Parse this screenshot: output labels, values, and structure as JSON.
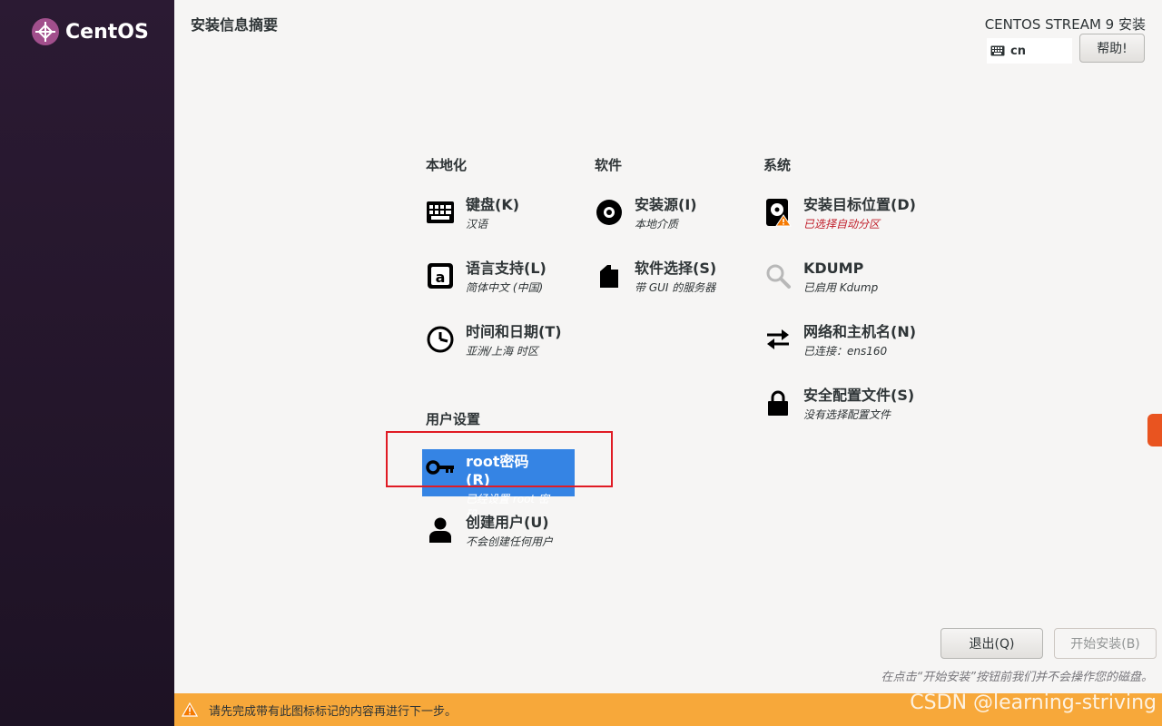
{
  "app": {
    "logo_text": "CentOS",
    "page_title": "安装信息摘要",
    "product_title": "CENTOS STREAM 9 安装",
    "keyboard_layout": "cn",
    "help_label": "帮助!"
  },
  "categories": {
    "localization": "本地化",
    "software": "软件",
    "system": "系统",
    "user_settings": "用户设置"
  },
  "spokes": {
    "keyboard": {
      "title": "键盘(K)",
      "status": "汉语",
      "icon": "keyboard-icon"
    },
    "language": {
      "title": "语言支持(L)",
      "status": "简体中文 (中国)",
      "icon": "language-icon"
    },
    "time": {
      "title": "时间和日期(T)",
      "status": "亚洲/上海 时区",
      "icon": "clock-icon"
    },
    "source": {
      "title": "安装源(I)",
      "status": "本地介质",
      "icon": "disc-icon"
    },
    "software": {
      "title": "软件选择(S)",
      "status": "带 GUI 的服务器",
      "icon": "package-icon"
    },
    "destination": {
      "title": "安装目标位置(D)",
      "status": "已选择自动分区",
      "icon": "harddisk-warning-icon"
    },
    "kdump": {
      "title": "KDUMP",
      "status": "已启用 Kdump",
      "icon": "magnifier-icon"
    },
    "network": {
      "title": "网络和主机名(N)",
      "status": "已连接：ens160",
      "icon": "network-arrows-icon"
    },
    "security": {
      "title": "安全配置文件(S)",
      "status": "没有选择配置文件",
      "icon": "lock-icon"
    },
    "root": {
      "title": "root密码(R)",
      "status": "已经设置 root 密码",
      "icon": "key-icon"
    },
    "user": {
      "title": "创建用户(U)",
      "status": "不会创建任何用户",
      "icon": "user-icon"
    }
  },
  "buttons": {
    "quit": "退出(Q)",
    "begin": "开始安装(B)"
  },
  "footnote": "在点击“开始安装”按钮前我们并不会操作您的磁盘。",
  "warning_bar": "请先完成带有此图标标记的内容再进行下一步。",
  "watermark": "CSDN @learning-striving",
  "colors": {
    "selection": "#3584e4",
    "warning_bar": "#f7a83a",
    "warning_text": "#c01c28",
    "sidebar": "#2b1a33",
    "highlight_border": "#e01b24"
  }
}
